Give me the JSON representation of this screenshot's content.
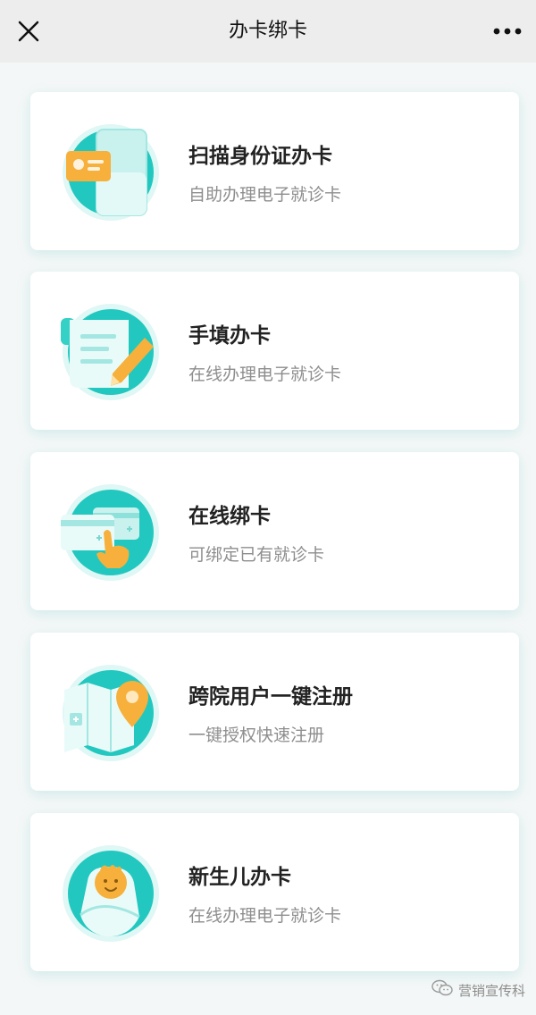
{
  "header": {
    "title": "办卡绑卡",
    "close_icon": "close-icon",
    "more_icon": "more-options-icon"
  },
  "cards": [
    {
      "title": "扫描身份证办卡",
      "subtitle": "自助办理电子就诊卡",
      "icon": "id-card-scan-icon"
    },
    {
      "title": "手填办卡",
      "subtitle": "在线办理电子就诊卡",
      "icon": "form-fill-icon"
    },
    {
      "title": "在线绑卡",
      "subtitle": "可绑定已有就诊卡",
      "icon": "card-bind-icon"
    },
    {
      "title": "跨院用户一键注册",
      "subtitle": "一键授权快速注册",
      "icon": "location-map-icon"
    },
    {
      "title": "新生儿办卡",
      "subtitle": "在线办理电子就诊卡",
      "icon": "newborn-icon"
    }
  ],
  "watermark": {
    "text": "营销宣传科",
    "icon": "wechat-icon"
  },
  "colors": {
    "accent": "#22c8bf",
    "accent_light": "#d7f6f3",
    "orange": "#f6b03b",
    "background": "#f4f7f7"
  }
}
